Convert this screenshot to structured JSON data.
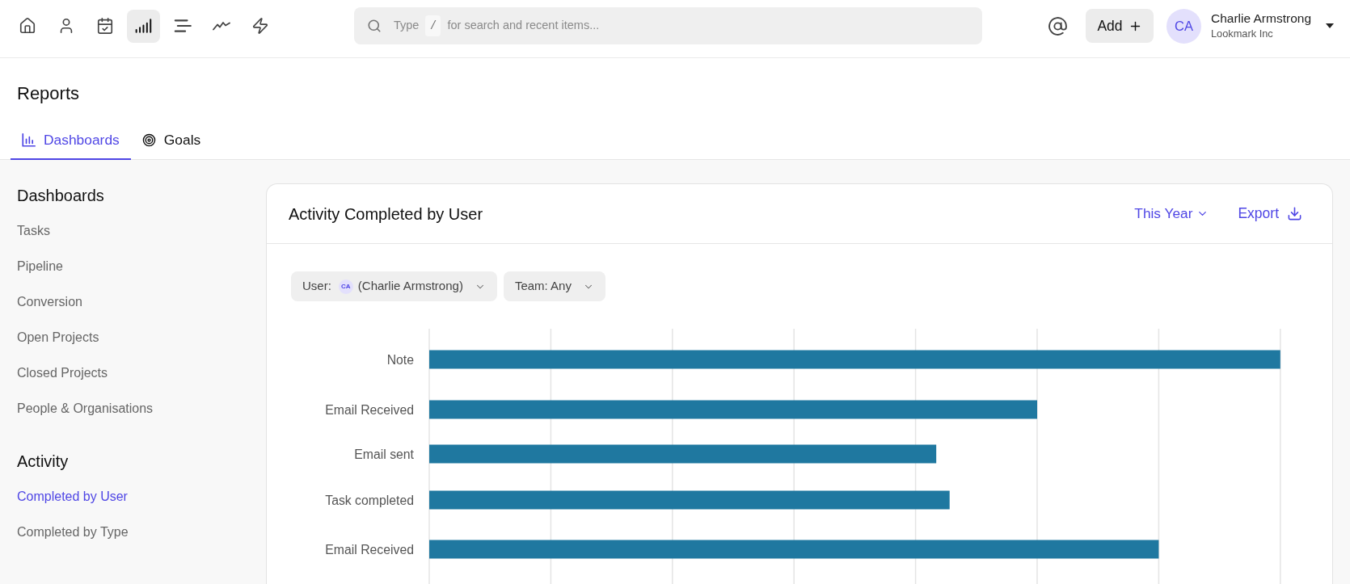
{
  "nav": [
    {
      "selected": false
    },
    {
      "selected": false
    },
    {
      "selected": false
    },
    {
      "selected": true
    },
    {
      "selected": false
    },
    {
      "selected": false
    },
    {
      "selected": false
    }
  ],
  "search": {
    "hint": "Type",
    "shortcut": "/",
    "placeholder": "for search and recent items..."
  },
  "add_button": {
    "label": "Add"
  },
  "account": {
    "initials": "CA",
    "name": "Charlie Armstrong",
    "company": "Lookmark Inc"
  },
  "page": {
    "title": "Reports"
  },
  "tabs": [
    {
      "label": "Dashboards",
      "selected": true
    },
    {
      "label": "Goals",
      "selected": false
    }
  ],
  "sidebar": {
    "sections": [
      {
        "title": "Dashboards",
        "items": [
          {
            "label": "Tasks",
            "selected": false
          },
          {
            "label": "Pipeline",
            "selected": false
          },
          {
            "label": "Conversion",
            "selected": false
          },
          {
            "label": "Open Projects",
            "selected": false
          },
          {
            "label": "Closed Projects",
            "selected": false
          },
          {
            "label": "People & Organisations",
            "selected": false
          }
        ]
      },
      {
        "title": "Activity",
        "items": [
          {
            "label": "Completed by User",
            "selected": true
          },
          {
            "label": "Completed by Type",
            "selected": false
          }
        ]
      }
    ]
  },
  "card": {
    "title": "Activity Completed by User",
    "period": "This Year",
    "export": "Export",
    "filters": [
      {
        "kind": "user",
        "label": "User:",
        "initials": "CA",
        "value": "(Charlie Armstrong)"
      },
      {
        "kind": "team",
        "label": "Team:",
        "value": "Any"
      }
    ],
    "chart": {
      "categories": [
        "Note",
        "Email Received",
        "Email sent",
        "Task completed",
        "Email Received"
      ]
    }
  }
}
